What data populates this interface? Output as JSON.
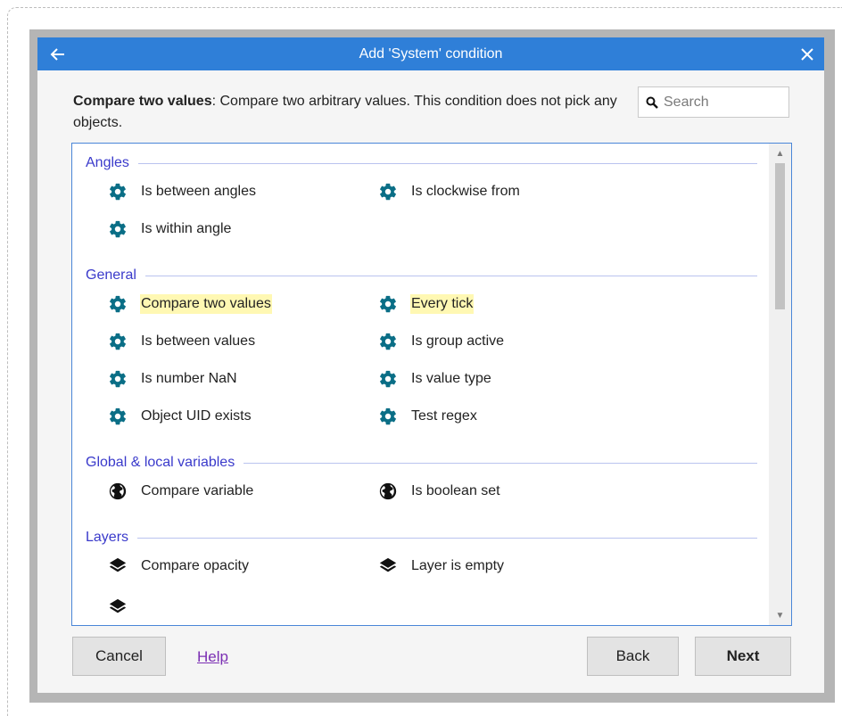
{
  "dialog": {
    "title": "Add 'System' condition",
    "back_icon": "arrow-left-icon",
    "close_icon": "close-icon"
  },
  "description": {
    "name": "Compare two values",
    "text": ": Compare two arbitrary values. This condition does not pick any objects."
  },
  "search": {
    "placeholder": "Search"
  },
  "colors": {
    "titlebar": "#2f7fd8",
    "section_title": "#3a3acb",
    "gear_icon": "#0a6e86",
    "highlight": "#fff8b3",
    "link": "#7b2fb3"
  },
  "sections": [
    {
      "title": "Angles",
      "items": [
        {
          "label": "Is between angles",
          "icon": "gear-icon"
        },
        {
          "label": "Is clockwise from",
          "icon": "gear-icon"
        },
        {
          "label": "Is within angle",
          "icon": "gear-icon"
        }
      ]
    },
    {
      "title": "General",
      "items": [
        {
          "label": "Compare two values",
          "icon": "gear-icon",
          "highlighted": true
        },
        {
          "label": "Every tick",
          "icon": "gear-icon",
          "highlighted": true
        },
        {
          "label": "Is between values",
          "icon": "gear-icon"
        },
        {
          "label": "Is group active",
          "icon": "gear-icon"
        },
        {
          "label": "Is number NaN",
          "icon": "gear-icon"
        },
        {
          "label": "Is value type",
          "icon": "gear-icon"
        },
        {
          "label": "Object UID exists",
          "icon": "gear-icon"
        },
        {
          "label": "Test regex",
          "icon": "gear-icon"
        }
      ]
    },
    {
      "title": "Global & local variables",
      "items": [
        {
          "label": "Compare variable",
          "icon": "globe-icon"
        },
        {
          "label": "Is boolean set",
          "icon": "globe-icon"
        }
      ]
    },
    {
      "title": "Layers",
      "items": [
        {
          "label": "Compare opacity",
          "icon": "layers-icon"
        },
        {
          "label": "Layer is empty",
          "icon": "layers-icon"
        }
      ]
    }
  ],
  "buttons": {
    "cancel": "Cancel",
    "help": "Help",
    "back": "Back",
    "next": "Next"
  }
}
